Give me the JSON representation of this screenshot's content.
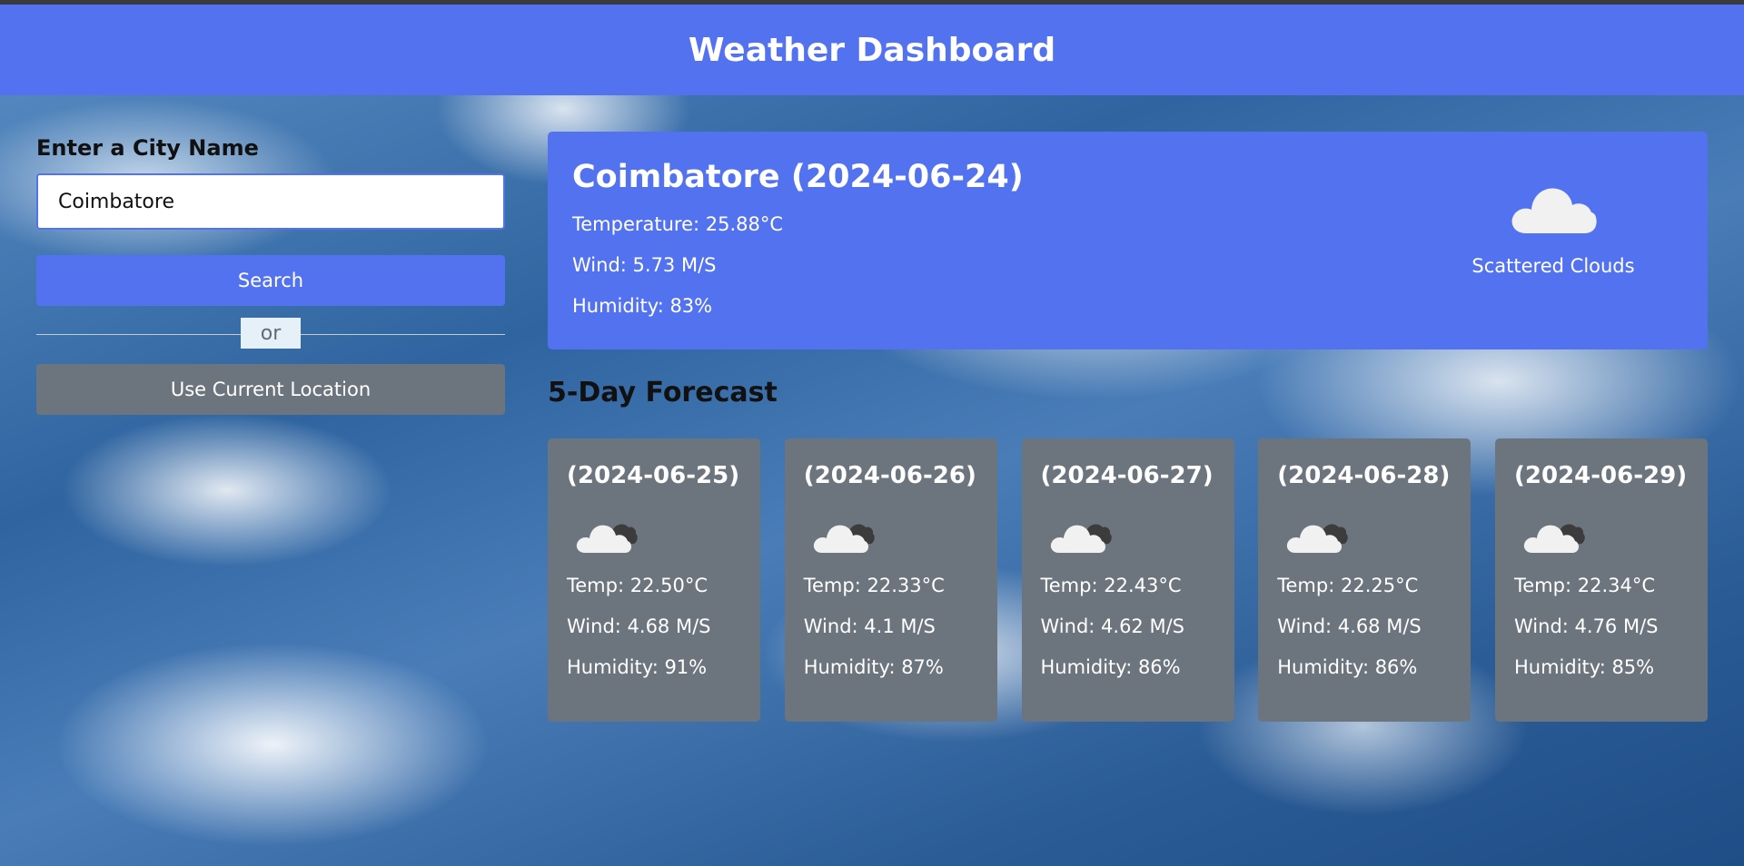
{
  "header": {
    "title": "Weather Dashboard"
  },
  "sidebar": {
    "city_label": "Enter a City Name",
    "city_input_value": "Coimbatore",
    "search_label": "Search",
    "divider_text": "or",
    "location_label": "Use Current Location"
  },
  "current": {
    "title": "Coimbatore (2024-06-24)",
    "temperature": "Temperature: 25.88°C",
    "wind": "Wind: 5.73 M/S",
    "humidity": "Humidity: 83%",
    "description": "Scattered Clouds",
    "icon": "scattered-clouds-icon"
  },
  "forecast": {
    "title": "5-Day Forecast",
    "days": [
      {
        "date": "(2024-06-25)",
        "icon": "broken-clouds-icon",
        "temp": "Temp: 22.50°C",
        "wind": "Wind: 4.68 M/S",
        "humidity": "Humidity: 91%"
      },
      {
        "date": "(2024-06-26)",
        "icon": "broken-clouds-icon",
        "temp": "Temp: 22.33°C",
        "wind": "Wind: 4.1 M/S",
        "humidity": "Humidity: 87%"
      },
      {
        "date": "(2024-06-27)",
        "icon": "broken-clouds-icon",
        "temp": "Temp: 22.43°C",
        "wind": "Wind: 4.62 M/S",
        "humidity": "Humidity: 86%"
      },
      {
        "date": "(2024-06-28)",
        "icon": "broken-clouds-icon",
        "temp": "Temp: 22.25°C",
        "wind": "Wind: 4.68 M/S",
        "humidity": "Humidity: 86%"
      },
      {
        "date": "(2024-06-29)",
        "icon": "broken-clouds-icon",
        "temp": "Temp: 22.34°C",
        "wind": "Wind: 4.76 M/S",
        "humidity": "Humidity: 85%"
      }
    ]
  },
  "colors": {
    "accent": "#5372f0",
    "card": "#6c757d",
    "text_light": "#ffffff"
  }
}
